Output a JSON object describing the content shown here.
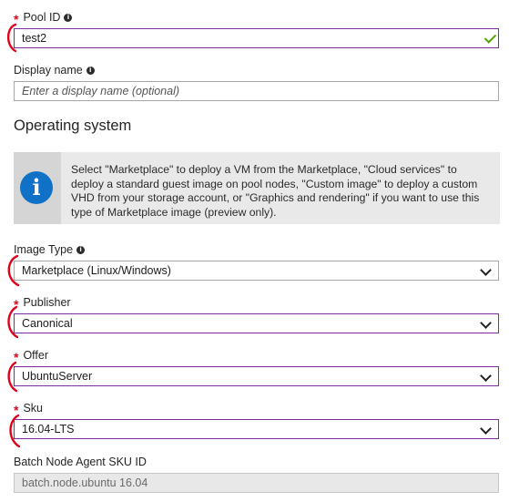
{
  "pool_id": {
    "label": "Pool ID",
    "value": "test2",
    "required": true
  },
  "display_name": {
    "label": "Display name",
    "placeholder": "Enter a display name (optional)"
  },
  "os_section": {
    "title": "Operating system"
  },
  "info_box": {
    "message": "Select \"Marketplace\" to deploy a VM from the Marketplace, \"Cloud services\" to deploy a standard guest image on pool nodes, \"Custom image\" to deploy a custom VHD from your storage account, or \"Graphics and rendering\" if you want to use this type of Marketplace image (preview only)."
  },
  "image_type": {
    "label": "Image Type",
    "value": "Marketplace (Linux/Windows)"
  },
  "publisher": {
    "label": "Publisher",
    "value": "Canonical",
    "required": true
  },
  "offer": {
    "label": "Offer",
    "value": "UbuntuServer",
    "required": true
  },
  "sku": {
    "label": "Sku",
    "value": "16.04-LTS",
    "required": true
  },
  "node_agent": {
    "label": "Batch Node Agent SKU ID",
    "value": "batch.node.ubuntu 16.04"
  },
  "colors": {
    "required": "#e00b1c",
    "valid_border": "#7a2e9e",
    "info_icon": "#0f72c6",
    "checkmark": "#57a300",
    "annotation": "#e0001a"
  },
  "icons": {
    "info": "info-icon",
    "valid": "checkmark-icon",
    "dropdown": "chevron-down-icon"
  }
}
